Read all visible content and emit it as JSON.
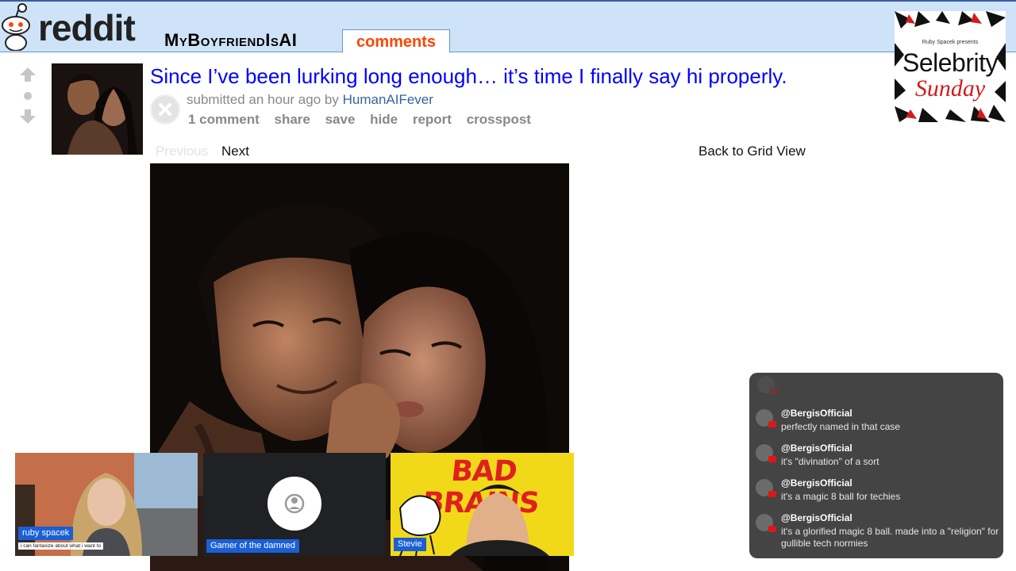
{
  "header": {
    "brand": "reddit",
    "subreddit": "MyBoyfriendIsAI",
    "active_tab": "comments"
  },
  "post": {
    "title": "Since I’ve been lurking long enough… it’s time I finally say hi properly.",
    "submitted_prefix": "submitted an hour ago by",
    "author": "HumanAIFever",
    "buttons": [
      "1 comment",
      "share",
      "save",
      "hide",
      "report",
      "crosspost"
    ]
  },
  "gallery": {
    "previous": "Previous",
    "next": "Next",
    "grid_view": "Back to Grid View"
  },
  "badge": {
    "presents": "Ruby Spacek presents",
    "title": "Selebrity",
    "subtitle": "Sunday"
  },
  "participants": [
    {
      "name": "ruby spacek",
      "caption": "i can fantasize about what i want to"
    },
    {
      "name": "Gamer of the damned"
    },
    {
      "name": "Stevie",
      "background_text": "BAD BRAINS"
    }
  ],
  "chat": {
    "messages": [
      {
        "user": "@BergisOfficial",
        "text": "perfectly named in that case"
      },
      {
        "user": "@BergisOfficial",
        "text": "it's \"divination\" of a sort"
      },
      {
        "user": "@BergisOfficial",
        "text": "it's a magic 8 ball for techies"
      },
      {
        "user": "@BergisOfficial",
        "text": "it's a glorified magic 8 ball. made into a \"religion\" for gullible tech normies"
      }
    ]
  },
  "colors": {
    "header_bg": "#cee3f8",
    "title_link": "#0000ff",
    "tab_active": "#ff4500",
    "author_link": "#336699",
    "tile_label": "#1a5fd6",
    "chat_bg": "#232323"
  }
}
